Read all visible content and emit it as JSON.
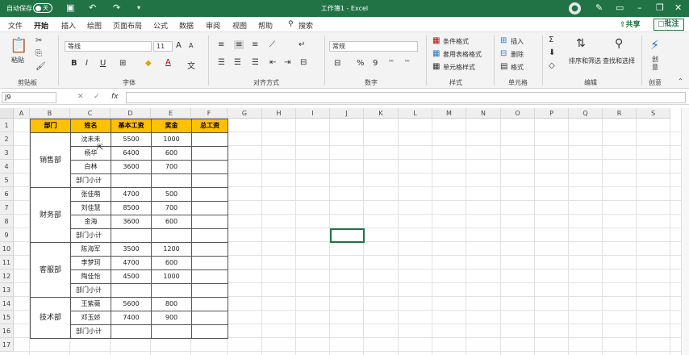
{
  "titlebar": {
    "autosave": "自动保存",
    "toggle_state": "关",
    "title": "工作簿1 - Excel",
    "icons": [
      "save-icon",
      "undo-icon",
      "redo-icon",
      "customize-icon",
      "user-icon",
      "pen-icon",
      "ribbon-display-icon",
      "minimize-icon",
      "restore-icon",
      "close-icon"
    ]
  },
  "menu": {
    "tabs": [
      "文件",
      "开始",
      "插入",
      "绘图",
      "页面布局",
      "公式",
      "数据",
      "审阅",
      "视图",
      "帮助"
    ],
    "active": "开始",
    "search": "搜索",
    "share": "共享",
    "comment": "批注"
  },
  "ribbon": {
    "clipboard": {
      "paste": "粘贴",
      "label": "剪贴板"
    },
    "font": {
      "name": "等线",
      "size": "11",
      "label": "字体",
      "bold": "B",
      "italic": "I",
      "underline": "U",
      "grow": "A",
      "shrink": "A",
      "font_color": "A"
    },
    "alignment": {
      "label": "对齐方式"
    },
    "number": {
      "format": "常规",
      "label": "数字",
      "percent": "%",
      "comma": "9"
    },
    "styles": {
      "conditional": "条件格式",
      "table": "套用表格格式",
      "cell_styles": "单元格样式",
      "label": "样式"
    },
    "cells": {
      "insert": "插入",
      "delete": "删除",
      "format": "格式",
      "label": "单元格"
    },
    "editing": {
      "sort": "排序和筛选",
      "find": "查找和选择",
      "label": "编辑"
    },
    "ideas": {
      "label_top": "创",
      "label_bottom": "意",
      "group": "创意"
    }
  },
  "formula_bar": {
    "name_box": "J9",
    "fx": "fx",
    "value": ""
  },
  "columns": [
    "A",
    "B",
    "C",
    "D",
    "E",
    "F",
    "G",
    "H",
    "I",
    "J",
    "K",
    "L",
    "M",
    "N",
    "O",
    "P",
    "Q",
    "R",
    "S"
  ],
  "rows": [
    "1",
    "2",
    "3",
    "4",
    "5",
    "6",
    "7",
    "8",
    "9",
    "10",
    "11",
    "12",
    "13",
    "14",
    "15",
    "16",
    "17"
  ],
  "table": {
    "headers": [
      "部门",
      "姓名",
      "基本工资",
      "奖金",
      "总工资"
    ],
    "departments": [
      "销售部",
      "财务部",
      "客服部",
      "技术部"
    ],
    "rows": [
      [
        "沈未未",
        "5500",
        "1000",
        ""
      ],
      [
        "杨华",
        "6400",
        "600",
        ""
      ],
      [
        "白林",
        "3600",
        "700",
        ""
      ],
      [
        "部门小计",
        "",
        "",
        ""
      ],
      [
        "张佳萌",
        "4700",
        "500",
        ""
      ],
      [
        "刘佳慧",
        "8500",
        "700",
        ""
      ],
      [
        "金海",
        "3600",
        "600",
        ""
      ],
      [
        "部门小计",
        "",
        "",
        ""
      ],
      [
        "陈海军",
        "3500",
        "1200",
        ""
      ],
      [
        "李梦珂",
        "4700",
        "600",
        ""
      ],
      [
        "陶佳怡",
        "4500",
        "1000",
        ""
      ],
      [
        "部门小计",
        "",
        "",
        ""
      ],
      [
        "王紫薇",
        "5600",
        "800",
        ""
      ],
      [
        "邓玉娇",
        "7400",
        "900",
        ""
      ],
      [
        "部门小计",
        "",
        "",
        ""
      ]
    ]
  },
  "colors": {
    "excel_green": "#217346",
    "header_fill": "#ffc000"
  }
}
